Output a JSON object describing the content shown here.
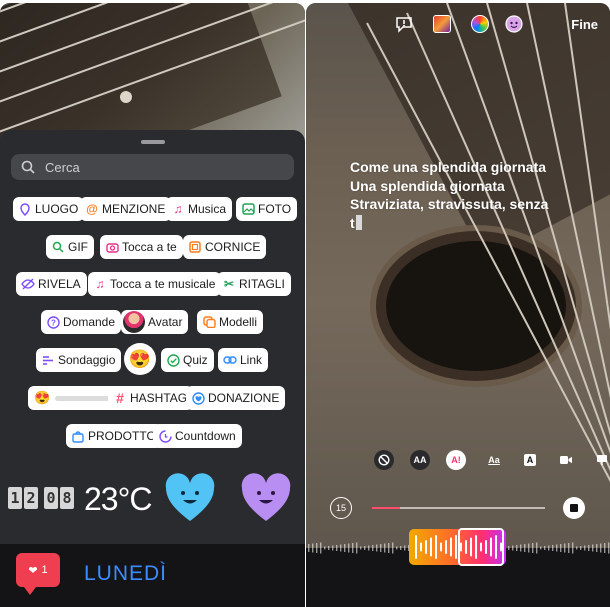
{
  "left": {
    "search": {
      "placeholder": "Cerca",
      "icon": "search-icon"
    },
    "stickers": [
      {
        "label": "LUOGO",
        "icon": "location-pin-icon",
        "color": "#7c4dff"
      },
      {
        "label": "MENZIONE",
        "icon": "at-sign-icon",
        "color": "#ff7a1a"
      },
      {
        "label": "Musica",
        "icon": "music-note-icon",
        "color": "#e8308a"
      },
      {
        "label": "FOTO",
        "icon": "photo-icon",
        "color": "#25a05a"
      },
      {
        "label": "GIF",
        "icon": "search-gif-icon",
        "color": "#1fa84f"
      },
      {
        "label": "Tocca a te",
        "icon": "camera-icon",
        "color": "#e8308a"
      },
      {
        "label": "CORNICE",
        "icon": "frame-icon",
        "color": "#ff7a1a"
      },
      {
        "label": "RIVELA",
        "icon": "eye-off-icon",
        "color": "#7c4dff"
      },
      {
        "label": "Tocca a te musicale",
        "icon": "music-note-icon",
        "color": "#e8308a"
      },
      {
        "label": "RITAGLI",
        "icon": "scissors-icon",
        "color": "#25a05a"
      },
      {
        "label": "Domande",
        "icon": "question-icon",
        "color": "#7c4dff"
      },
      {
        "label": "Avatar",
        "icon": "avatar-icon",
        "color": "#7c4dff"
      },
      {
        "label": "Modelli",
        "icon": "templates-icon",
        "color": "#ff7a1a"
      },
      {
        "label": "Sondaggio",
        "icon": "poll-icon",
        "color": "#7c4dff"
      },
      {
        "label": "Quiz",
        "icon": "check-circle-icon",
        "color": "#1fa84f"
      },
      {
        "label": "Link",
        "icon": "link-icon",
        "color": "#2f8cff"
      },
      {
        "label": "HASHTAG",
        "icon": "hashtag-icon",
        "color": "#ff4d6d"
      },
      {
        "label": "DONAZIONE",
        "icon": "donation-icon",
        "color": "#2f8cff"
      },
      {
        "label": "PRODOTTO",
        "icon": "shopping-bag-icon",
        "color": "#2f8cff"
      },
      {
        "label": "Countdown",
        "icon": "countdown-icon",
        "color": "#7c4dff"
      }
    ],
    "emoji_sticker": "😍",
    "slider_emoji": "😍",
    "clock": {
      "digits": [
        "1",
        "2",
        "0",
        "8"
      ]
    },
    "temperature": "23°C",
    "like_count": "1",
    "day_label": "LUNEDÌ"
  },
  "right": {
    "done_label": "Fine",
    "top_icons": [
      "alert-icon",
      "album-cover-icon",
      "color-picker-icon",
      "face-effect-icon"
    ],
    "lyrics": [
      "Come una splendida giornata",
      "Una splendida giornata",
      "Straviziata, stravissuta, senza",
      "t"
    ],
    "tools": [
      {
        "icon": "no-circle-icon",
        "label": ""
      },
      {
        "icon": "text-style-icon",
        "label": "AA"
      },
      {
        "icon": "lyrics-mode-icon",
        "label": "A!"
      },
      {
        "icon": "text-underline-icon",
        "label": "Aa"
      },
      {
        "icon": "text-background-icon",
        "label": "A"
      },
      {
        "icon": "video-icon",
        "label": ""
      },
      {
        "icon": "display-icon",
        "label": ""
      }
    ],
    "duration": "15",
    "progress_fraction": 0.16,
    "colors": {
      "accent": "#ff2f6e",
      "brand_like": "#ef3e4f",
      "day_blue": "#3b8cff"
    }
  }
}
